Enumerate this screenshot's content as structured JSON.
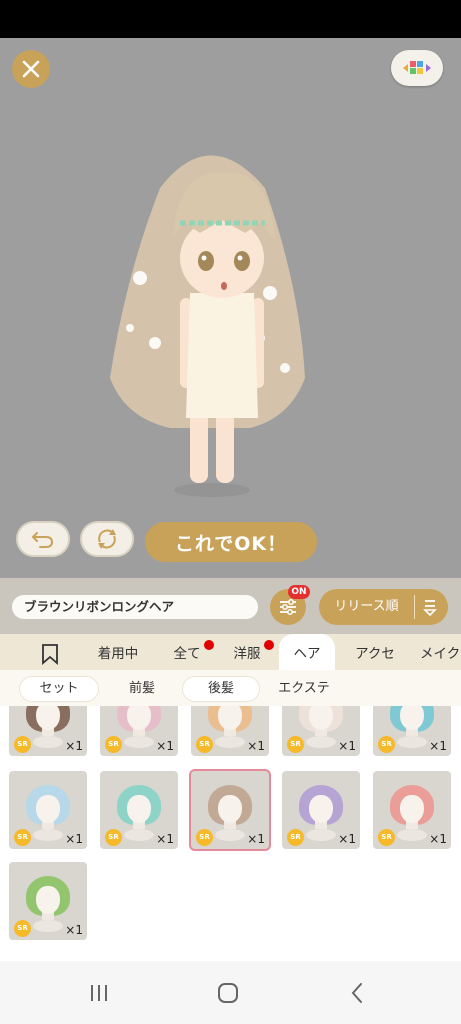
{
  "preview": {
    "ok_button": "これでOK！"
  },
  "filter_bar": {
    "item_name": "ブラウンリボンロングヘア",
    "filter_badge": "ON",
    "sort_label": "リリース順"
  },
  "category_tabs": [
    {
      "label": "着用中"
    },
    {
      "label": "全て"
    },
    {
      "label": "洋服"
    },
    {
      "label": "ヘア"
    },
    {
      "label": "アクセ"
    },
    {
      "label": "メイク"
    }
  ],
  "sub_tabs": [
    {
      "label": "セット"
    },
    {
      "label": "前髪"
    },
    {
      "label": "後髪"
    },
    {
      "label": "エクステ"
    }
  ],
  "items": [
    {
      "rarity": "SR",
      "count": "×1",
      "hair_color": "#6e4a3a"
    },
    {
      "rarity": "SR",
      "count": "×1",
      "hair_color": "#e9b6c8"
    },
    {
      "rarity": "SR",
      "count": "×1",
      "hair_color": "#f0b67a"
    },
    {
      "rarity": "SR",
      "count": "×1",
      "hair_color": "#f3e6dc"
    },
    {
      "rarity": "SR",
      "count": "×1",
      "hair_color": "#5fc4d6"
    },
    {
      "rarity": "SR",
      "count": "×1",
      "hair_color": "#a9d8f0"
    },
    {
      "rarity": "SR",
      "count": "×1",
      "hair_color": "#74d1c4"
    },
    {
      "rarity": "SR",
      "count": "×1",
      "hair_color": "#b89a82",
      "selected": true
    },
    {
      "rarity": "SR",
      "count": "×1",
      "hair_color": "#a893d6"
    },
    {
      "rarity": "SR",
      "count": "×1",
      "hair_color": "#f08a86"
    },
    {
      "rarity": "SR",
      "count": "×1",
      "hair_color": "#7bbf4e"
    }
  ],
  "colors": {
    "accent_gold": "#c9a25a",
    "preview_bg": "#9e9e9e",
    "notification_red": "#e00000",
    "selected_border": "#e58a9a"
  }
}
